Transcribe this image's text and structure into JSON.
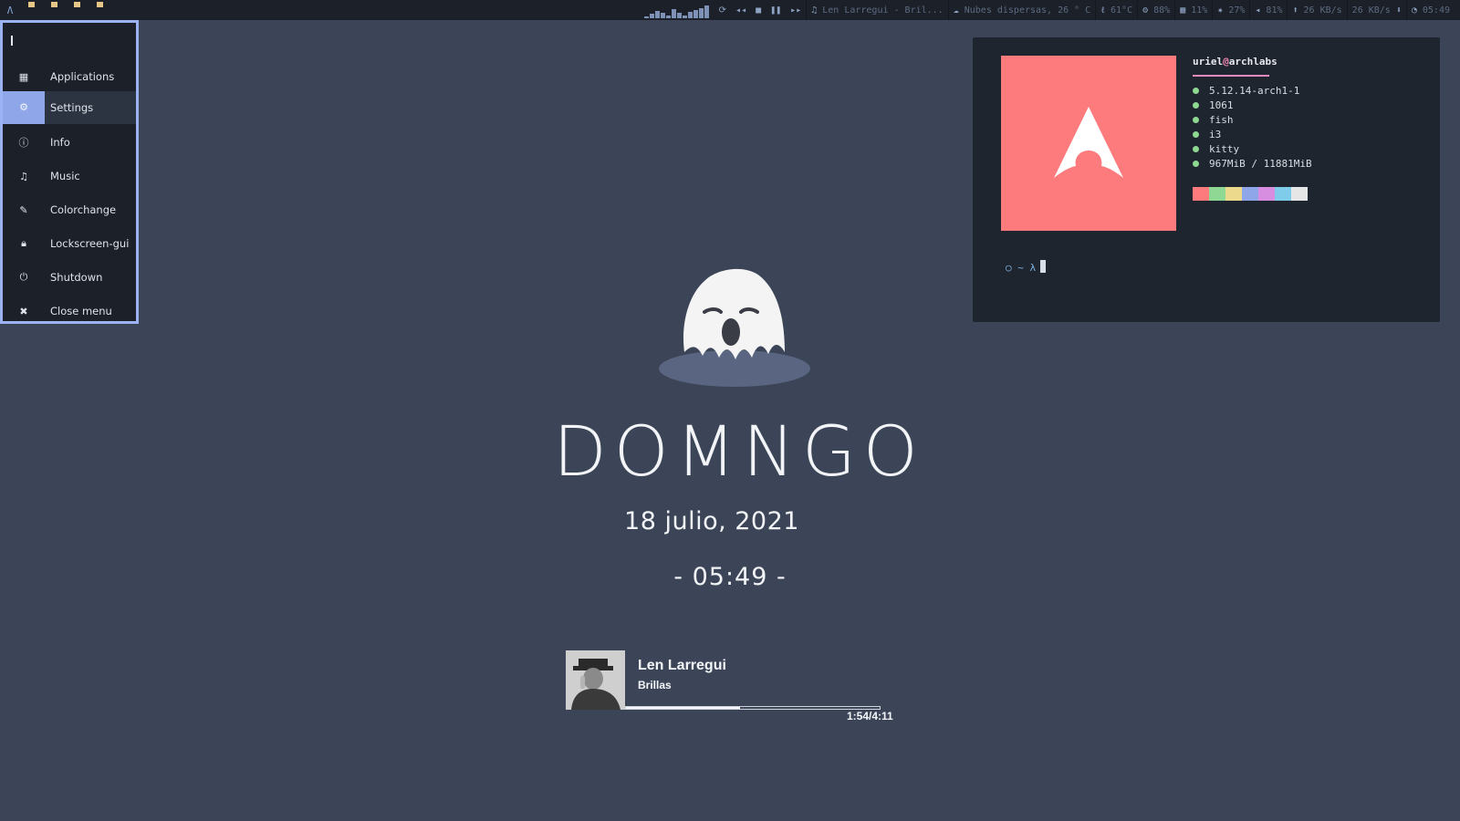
{
  "topbar": {
    "workspaces_count": 4,
    "workspace_color": "#e7c787",
    "visualizer_levels": [
      0.15,
      0.3,
      0.5,
      0.35,
      0.2,
      0.6,
      0.4,
      0.2,
      0.45,
      0.55,
      0.7,
      0.9
    ],
    "now_playing": "Len Larregui - Bril...",
    "weather": "Nubes dispersas, 26 ° C",
    "temperature": "61°C",
    "cpu": "88%",
    "memory": "11%",
    "brightness": "27%",
    "volume": "81%",
    "upload": "26 KB/s",
    "download": "26 KB/s",
    "clock": "05:49"
  },
  "menu": {
    "items": [
      {
        "label": "Applications",
        "icon": "grid-icon"
      },
      {
        "label": "Settings",
        "icon": "gear-icon",
        "selected": true
      },
      {
        "label": "Info",
        "icon": "info-icon"
      },
      {
        "label": "Music",
        "icon": "music-note-icon"
      },
      {
        "label": "Colorchange",
        "icon": "paint-icon"
      },
      {
        "label": "Lockscreen-gui",
        "icon": "lock-icon"
      },
      {
        "label": "Shutdown",
        "icon": "power-icon"
      },
      {
        "label": "Close menu",
        "icon": "close-icon"
      }
    ]
  },
  "terminal": {
    "user": "uriel",
    "at": "@",
    "host": "archlabs",
    "fetch": [
      "5.12.14-arch1-1",
      "1061",
      "fish",
      "i3",
      "kitty",
      "967MiB / 11881MiB"
    ],
    "palette": [
      "#fe7b7d",
      "#8fd894",
      "#ecd98c",
      "#8fa6e8",
      "#d78ee0",
      "#7fcbea",
      "#e6e6e6"
    ],
    "prompt": "○ ~ λ"
  },
  "center": {
    "day": "DOMNGO",
    "date": "18 julio, 2021",
    "time": "- 05:49 -"
  },
  "music": {
    "artist": "Len Larregui",
    "song": "Brillas",
    "progress_time": "1:54/4:11",
    "progress_fraction": 0.45
  },
  "colors": {
    "background": "#3b4557",
    "bar": "#1b2029",
    "accent": "#9bb3f2",
    "arch_logo_bg": "#fe7b7d"
  }
}
